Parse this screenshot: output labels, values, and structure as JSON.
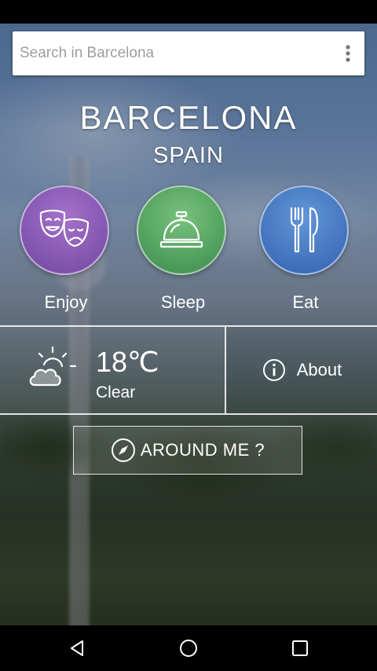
{
  "search": {
    "placeholder": "Search in Barcelona"
  },
  "location": {
    "city": "BARCELONA",
    "country": "SPAIN"
  },
  "categories": [
    {
      "label": "Enjoy",
      "icon": "theater-masks-icon",
      "color": "#8e56c0"
    },
    {
      "label": "Sleep",
      "icon": "hotel-bell-icon",
      "color": "#4fa35a"
    },
    {
      "label": "Eat",
      "icon": "fork-knife-icon",
      "color": "#3f78c8"
    }
  ],
  "weather": {
    "temperature": "18℃",
    "condition": "Clear",
    "icon": "partly-cloudy-icon"
  },
  "about": {
    "label": "About",
    "icon": "info-icon"
  },
  "around": {
    "label": "AROUND ME ?",
    "icon": "compass-icon"
  },
  "navbar": {
    "icons": [
      "back-icon",
      "home-icon",
      "recents-icon"
    ]
  }
}
